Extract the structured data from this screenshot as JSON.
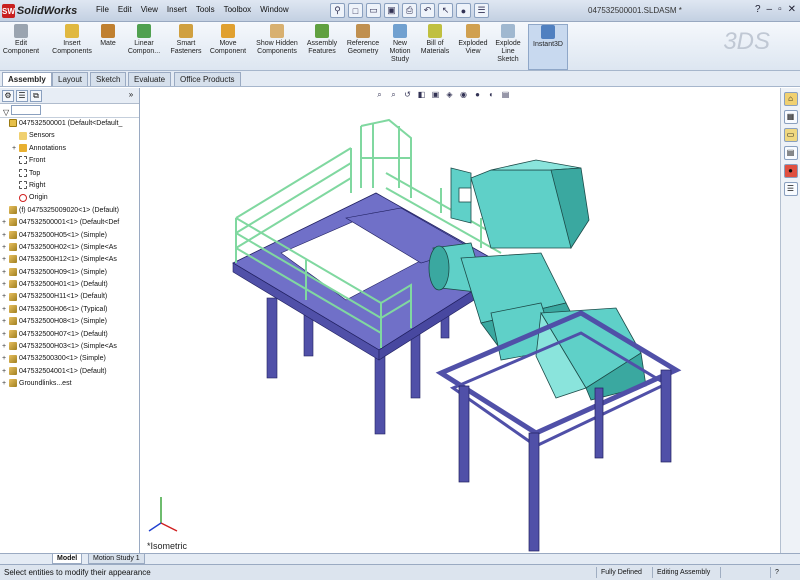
{
  "app": {
    "name": "SolidWorks",
    "logo_mark": "SW",
    "document_title": "047532500001.SLDASM *"
  },
  "menus": [
    "File",
    "Edit",
    "View",
    "Insert",
    "Tools",
    "Toolbox",
    "Window"
  ],
  "quick_access": [
    "pin-icon",
    "new-icon",
    "open-icon",
    "save-icon",
    "print-icon",
    "undo-icon",
    "select-icon",
    "rebuild-icon",
    "options-icon"
  ],
  "window_controls": {
    "help": "?",
    "minimize": "–",
    "restore": "▫",
    "close": "✕"
  },
  "commands": [
    {
      "label": "Edit Component",
      "icon": "edit-component-icon",
      "color": "#9aa4b0"
    },
    {
      "label": "Insert Components",
      "icon": "insert-components-icon",
      "color": "#e0b840"
    },
    {
      "label": "Mate",
      "icon": "mate-icon",
      "color": "#c08030"
    },
    {
      "label": "Linear Compon...",
      "icon": "linear-pattern-icon",
      "color": "#50a050"
    },
    {
      "label": "Smart Fasteners",
      "icon": "smart-fasteners-icon",
      "color": "#d0a040"
    },
    {
      "label": "Move Component",
      "icon": "move-component-icon",
      "color": "#e0a030"
    },
    {
      "label": "Show Hidden Components",
      "icon": "show-hidden-icon",
      "color": "#d8b070"
    },
    {
      "label": "Assembly Features",
      "icon": "assembly-features-icon",
      "color": "#60a040"
    },
    {
      "label": "Reference Geometry",
      "icon": "reference-geometry-icon",
      "color": "#c09050"
    },
    {
      "label": "New Motion Study",
      "icon": "motion-study-icon",
      "color": "#70a0d0"
    },
    {
      "label": "Bill of Materials",
      "icon": "bom-icon",
      "color": "#c0c040"
    },
    {
      "label": "Exploded View",
      "icon": "exploded-view-icon",
      "color": "#d0a050"
    },
    {
      "label": "Explode Line Sketch",
      "icon": "explode-line-icon",
      "color": "#a0b8d0"
    },
    {
      "label": "Instant3D",
      "icon": "instant3d-icon",
      "color": "#5080c0",
      "active": true
    }
  ],
  "command_tabs": [
    {
      "label": "Assembly",
      "active": true
    },
    {
      "label": "Layout"
    },
    {
      "label": "Sketch"
    },
    {
      "label": "Evaluate"
    },
    {
      "label": "Office Products"
    }
  ],
  "feature_tree": {
    "tool_icons": [
      "feature-manager-icon",
      "property-manager-icon",
      "configuration-manager-icon"
    ],
    "collapse_glyph": "»",
    "filter_glyph": "▽",
    "items": [
      {
        "label": "047532500001 (Default<Default_",
        "icon": "asm",
        "toggle": "",
        "indent": 0
      },
      {
        "label": "Sensors",
        "icon": "sens",
        "toggle": "",
        "indent": 1
      },
      {
        "label": "Annotations",
        "icon": "annot",
        "toggle": "+",
        "indent": 1
      },
      {
        "label": "Front",
        "icon": "plane",
        "toggle": "",
        "indent": 1
      },
      {
        "label": "Top",
        "icon": "plane",
        "toggle": "",
        "indent": 1
      },
      {
        "label": "Right",
        "icon": "plane",
        "toggle": "",
        "indent": 1
      },
      {
        "label": "Origin",
        "icon": "origin",
        "toggle": "",
        "indent": 1
      },
      {
        "label": "(f) 0475325009020<1> (Default)",
        "icon": "part",
        "toggle": "",
        "indent": 0
      },
      {
        "label": "047532500001<1> (Default<Def",
        "icon": "part",
        "toggle": "+",
        "indent": 0
      },
      {
        "label": "047532500H05<1> (Simple)",
        "icon": "part",
        "toggle": "+",
        "indent": 0
      },
      {
        "label": "047532500H02<1> (Simple<As",
        "icon": "part",
        "toggle": "+",
        "indent": 0
      },
      {
        "label": "047532500H12<1> (Simple<As",
        "icon": "part",
        "toggle": "+",
        "indent": 0
      },
      {
        "label": "047532500H09<1> (Simple)",
        "icon": "part",
        "toggle": "+",
        "indent": 0
      },
      {
        "label": "047532500H01<1> (Default)",
        "icon": "part",
        "toggle": "+",
        "indent": 0
      },
      {
        "label": "047532500H11<1> (Default)",
        "icon": "part",
        "toggle": "+",
        "indent": 0
      },
      {
        "label": "047532500H06<1> (Typical)",
        "icon": "part",
        "toggle": "+",
        "indent": 0
      },
      {
        "label": "047532500H08<1> (Simple)",
        "icon": "part",
        "toggle": "+",
        "indent": 0
      },
      {
        "label": "047532500H07<1> (Default)",
        "icon": "part",
        "toggle": "+",
        "indent": 0
      },
      {
        "label": "047532500H03<1> (Simple<As",
        "icon": "part",
        "toggle": "+",
        "indent": 0
      },
      {
        "label": "047532500300<1> (Simple)",
        "icon": "part",
        "toggle": "+",
        "indent": 0
      },
      {
        "label": "047532504001<1> (Default)",
        "icon": "part",
        "toggle": "+",
        "indent": 0
      },
      {
        "label": "Groundlinks...est",
        "icon": "part",
        "toggle": "+",
        "indent": 0
      }
    ]
  },
  "viewport": {
    "label": "*Isometric"
  },
  "view_tools": [
    "zoom-fit-icon",
    "zoom-area-icon",
    "previous-view-icon",
    "section-view-icon",
    "view-orientation-icon",
    "display-style-icon",
    "hide-show-icon",
    "appearance-icon",
    "scene-icon",
    "view-settings-icon"
  ],
  "task_pane": [
    "home-icon",
    "design-library-icon",
    "file-explorer-icon",
    "view-palette-icon",
    "appearances-icon",
    "custom-properties-icon"
  ],
  "bottom_tabs": [
    {
      "label": "Model",
      "active": true
    },
    {
      "label": "Motion Study 1"
    }
  ],
  "status": {
    "message": "Select entities to modify their appearance",
    "cells": [
      "Fully Defined",
      "Editing Assembly",
      "",
      "?"
    ]
  },
  "colors": {
    "frame": "#5050a8",
    "duct": "#5fd0c8",
    "handrail": "#80d8a0",
    "deck": "#7070c8"
  }
}
